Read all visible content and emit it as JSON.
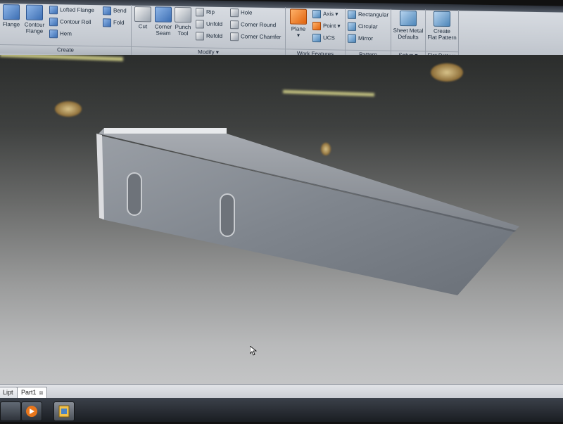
{
  "ribbon": {
    "panels": [
      {
        "title": "Create"
      },
      {
        "title": "Modify ▾"
      },
      {
        "title": "Work Features"
      },
      {
        "title": "Pattern"
      },
      {
        "title": "Setup ▾"
      },
      {
        "title": "Flat Pattern"
      }
    ],
    "create": {
      "flange": "Flange",
      "contour_flange_1": "Contour",
      "contour_flange_2": "Flange",
      "lofted_flange": "Lofted Flange",
      "contour_roll": "Contour Roll",
      "hem": "Hem",
      "bend": "Bend",
      "fold": "Fold"
    },
    "modify": {
      "cut": "Cut",
      "corner_seam_1": "Corner",
      "corner_seam_2": "Seam",
      "punch_tool_1": "Punch",
      "punch_tool_2": "Tool",
      "rip": "Rip",
      "unfold": "Unfold",
      "refold": "Refold",
      "hole": "Hole",
      "corner_round": "Corner Round",
      "corner_chamfer": "Corner Chamfer"
    },
    "work_features": {
      "plane": "Plane",
      "axis": "Axis ▾",
      "point": "Point ▾",
      "ucs": "UCS"
    },
    "pattern": {
      "rectangular": "Rectangular",
      "circular": "Circular",
      "mirror": "Mirror"
    },
    "setup": {
      "sheet_metal_defaults_1": "Sheet Metal",
      "sheet_metal_defaults_2": "Defaults"
    },
    "flat_pattern": {
      "create_flat_pattern_1": "Create",
      "create_flat_pattern_2": "Flat Pattern"
    }
  },
  "tabs": {
    "left": "Lipt",
    "active": "Part1",
    "close": "⊠"
  },
  "colors": {
    "part_face": "#858b93",
    "part_top": "#c9ccd0",
    "accent_orange": "#e0620c"
  }
}
